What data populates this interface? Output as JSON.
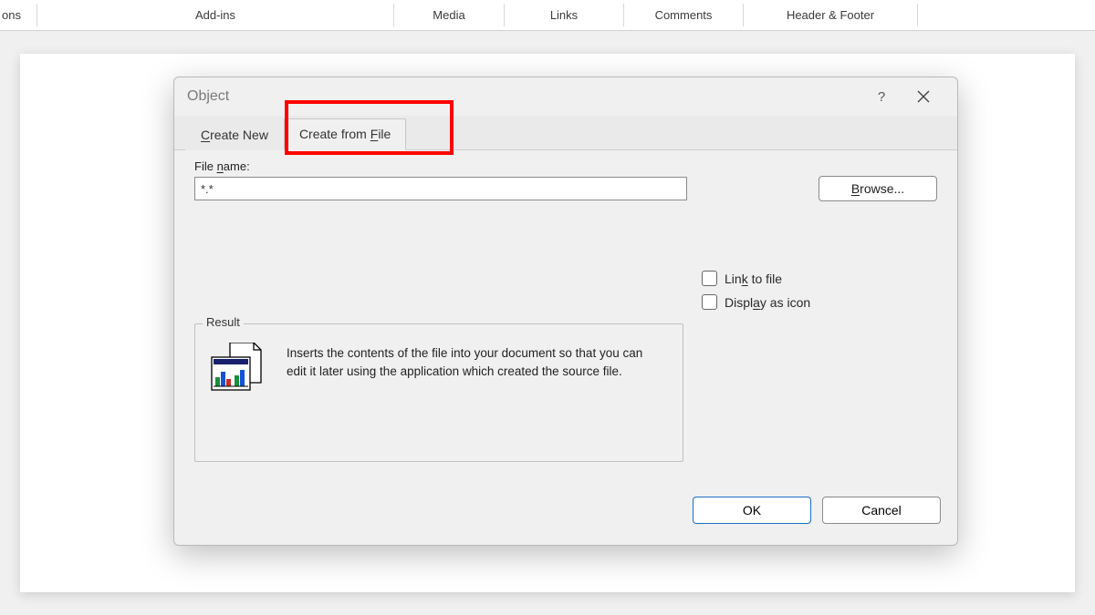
{
  "ribbon": {
    "items": [
      "ons",
      "Add-ins",
      "Media",
      "Links",
      "Comments",
      "Header & Footer"
    ]
  },
  "dialog": {
    "title": "Object",
    "tabs": {
      "create_new": "Create New",
      "create_from_file": "Create from File"
    },
    "file_name_label": "File name:",
    "file_name_value": "*.*",
    "browse_label": "Browse...",
    "link_to_file_label": "Link to file",
    "display_as_icon_label": "Display as icon",
    "result_legend": "Result",
    "result_text": "Inserts the contents of the file into your document so that you can edit it later using the application which created the source file.",
    "ok_label": "OK",
    "cancel_label": "Cancel"
  }
}
